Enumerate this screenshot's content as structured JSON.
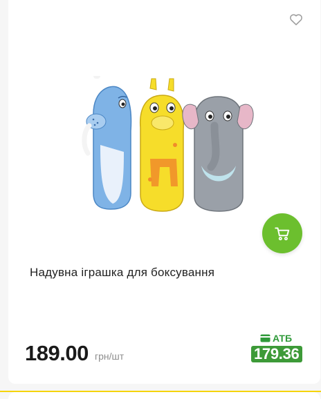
{
  "product": {
    "title": "Надувна іграшка для боксування",
    "price": "189.00",
    "price_unit": "грн/шт",
    "promo": {
      "store_label": "АТБ",
      "price": "179.36"
    },
    "image_icon": "inflatable-punching-toys-image"
  },
  "icons": {
    "favorite": "heart-outline-icon",
    "cart": "cart-icon",
    "promo": "wallet-card-icon"
  },
  "colors": {
    "accent_green": "#6cbf2e",
    "promo_green": "#3d9a38",
    "divider_yellow": "#f5d400"
  }
}
